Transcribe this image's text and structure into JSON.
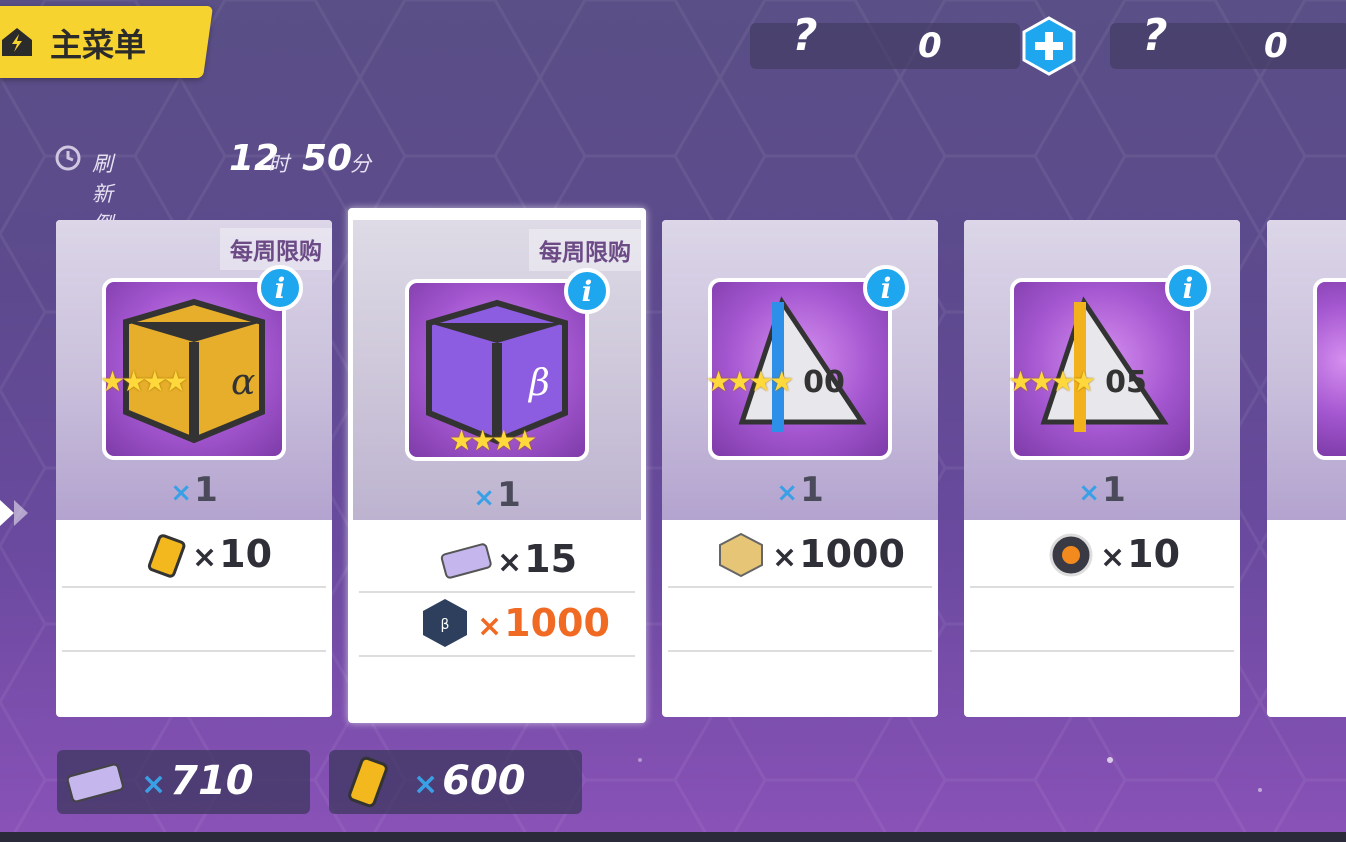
{
  "header": {
    "menu_label": "主菜单",
    "resource1": {
      "value": "0"
    },
    "resource2": {
      "value": "0"
    },
    "unknown_glyph": "?"
  },
  "timer": {
    "label": "刷新倒计时",
    "hours": "12",
    "hours_unit": "时",
    "minutes": "50",
    "minutes_unit": "分"
  },
  "cards": [
    {
      "tag": "每周限购",
      "item_icon": "alpha-cube-icon",
      "stars": "★★★★",
      "qty": "1",
      "prices": [
        {
          "icon": "battery-icon",
          "value": "10"
        }
      ]
    },
    {
      "tag": "每周限购",
      "item_icon": "beta-cube-icon",
      "stars": "★★★★",
      "qty": "1",
      "prices": [
        {
          "icon": "pass-ticket-icon",
          "value": "15"
        },
        {
          "icon": "beta-test-coin-icon",
          "value": "1000"
        }
      ]
    },
    {
      "tag": "",
      "item_icon": "blue-shard-00-icon",
      "stars": "★★★★",
      "qty": "1",
      "prices": [
        {
          "icon": "gold-coin-icon",
          "value": "1000"
        }
      ]
    },
    {
      "tag": "",
      "item_icon": "gold-shard-05-icon",
      "stars": "★★★★",
      "qty": "1",
      "prices": [
        {
          "icon": "orb-icon",
          "value": "10"
        }
      ]
    }
  ],
  "x_mark": "×",
  "currency": [
    {
      "icon": "pass-ticket-icon",
      "value": "710"
    },
    {
      "icon": "battery-icon",
      "value": "600"
    }
  ],
  "colors": {
    "accent_yellow": "#f7d330",
    "accent_blue": "#3aa0e6",
    "highlight_red": "#f06a24"
  }
}
